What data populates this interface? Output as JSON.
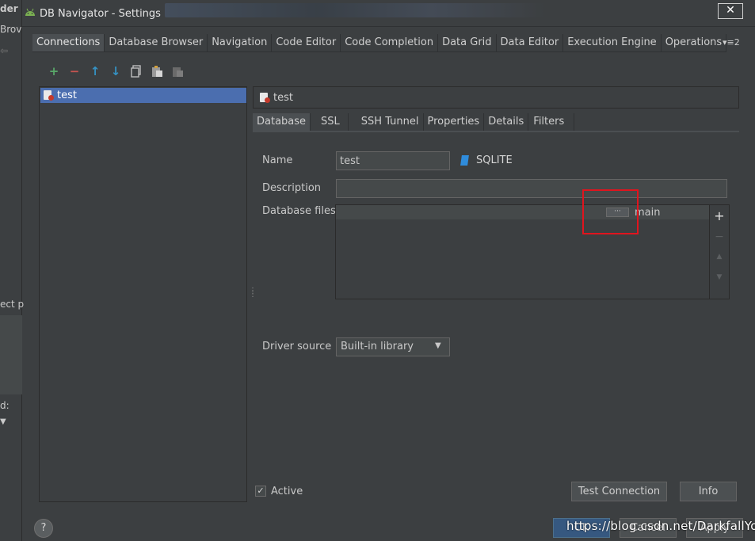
{
  "window": {
    "title": "DB Navigator - Settings",
    "close_label": "✕"
  },
  "background_ide": {
    "fragments": [
      "der",
      "Brov",
      "ect p",
      "d:"
    ]
  },
  "top_tabs": [
    {
      "label": "Connections",
      "active": true
    },
    {
      "label": "Database Browser"
    },
    {
      "label": "Navigation"
    },
    {
      "label": "Code Editor"
    },
    {
      "label": "Code Completion"
    },
    {
      "label": "Data Grid"
    },
    {
      "label": "Data Editor"
    },
    {
      "label": "Execution Engine"
    },
    {
      "label": "Operations"
    }
  ],
  "tabs_more_label": "▾≡2",
  "toolbar": {
    "add": "+",
    "remove": "−",
    "move_up": "↑",
    "move_down": "↓",
    "icons": [
      "plus-icon",
      "minus-icon",
      "arrow-up-icon",
      "arrow-down-icon",
      "copy-icon",
      "paste-icon",
      "paste-disabled-icon"
    ]
  },
  "connections": {
    "items": [
      {
        "label": "test",
        "selected": true
      }
    ]
  },
  "connection_header": {
    "label": "test"
  },
  "sub_tabs": [
    {
      "label": "Database",
      "active": true
    },
    {
      "label": "SSL"
    },
    {
      "label": "SSH Tunnel"
    },
    {
      "label": "Properties"
    },
    {
      "label": "Details"
    },
    {
      "label": "Filters"
    }
  ],
  "form": {
    "name_label": "Name",
    "name_value": "test",
    "db_type": "SQLITE",
    "description_label": "Description",
    "description_value": "",
    "files_label": "Database files",
    "files_rows": [
      {
        "path": "",
        "browse": "···",
        "schema": "main"
      }
    ],
    "files_side": {
      "add": "+",
      "remove": "−",
      "up": "▲",
      "down": "▼"
    },
    "driver_label": "Driver source",
    "driver_value": "Built-in library",
    "driver_arrow": "▼"
  },
  "bottom": {
    "active_label": "Active",
    "active_checked": true,
    "check_glyph": "✓",
    "test_connection": "Test Connection",
    "info": "Info",
    "help": "?",
    "ok": "OK",
    "cancel": "Cancel",
    "apply": "Apply",
    "watermark": "https://blog.csdn.net/DarkfallYou"
  },
  "colors": {
    "background": "#3c3f41",
    "selection": "#4b6eaf",
    "highlight_box": "#e0141e",
    "add_green": "#59a869",
    "remove_red": "#c75450",
    "arrow_blue": "#3592c4"
  }
}
